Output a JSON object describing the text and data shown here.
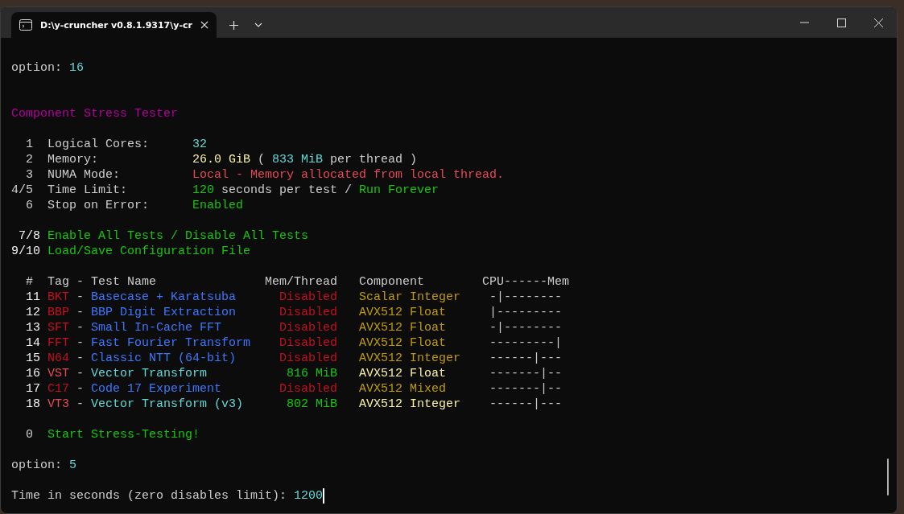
{
  "window": {
    "tabs": [
      {
        "title": "D:\\y-cruncher v0.8.1.9317\\y-cr",
        "selected": true
      }
    ]
  },
  "terminal": {
    "blocks": [
      {
        "kind": "prompt",
        "label": "option:",
        "value": "16"
      },
      {
        "kind": "heading",
        "text": "Component Stress Tester"
      },
      {
        "kind": "settings",
        "items": [
          {
            "key": "1",
            "label": "Logical Cores:",
            "spans": [
              {
                "text": "32",
                "color": "#61d6d6"
              }
            ]
          },
          {
            "key": "2",
            "label": "Memory:",
            "spans": [
              {
                "text": "26.0 GiB",
                "color": "#f9f1a5"
              },
              {
                "text": "(",
                "color": "#cccccc"
              },
              {
                "text": "833 MiB",
                "color": "#61d6d6"
              },
              {
                "text": "per thread )",
                "color": "#cccccc"
              }
            ]
          },
          {
            "key": "3",
            "label": "NUMA Mode:",
            "spans": [
              {
                "text": "Local - Memory allocated from local thread.",
                "color": "#e74856"
              }
            ]
          },
          {
            "key": "4/5",
            "label": "Time Limit:",
            "spans": [
              {
                "text": "120",
                "color": "#16c60c"
              },
              {
                "text": "seconds per test /",
                "color": "#cccccc"
              },
              {
                "text": "Run Forever",
                "color": "#16c60c"
              }
            ]
          },
          {
            "key": "6",
            "label": "Stop on Error:",
            "spans": [
              {
                "text": "Enabled",
                "color": "#16c60c"
              }
            ]
          }
        ]
      },
      {
        "kind": "actions",
        "items": [
          {
            "key": "7/8",
            "text": "Enable All Tests / Disable All Tests"
          },
          {
            "key": "9/10",
            "text": "Load/Save Configuration File"
          }
        ]
      },
      {
        "kind": "table",
        "columns": [
          "#",
          "Tag - Test Name",
          "Mem/Thread",
          "Component",
          "CPU------Mem"
        ],
        "rows": [
          {
            "num": "11",
            "tag": "BKT",
            "sep": "-",
            "name": "Basecase + Karatsuba",
            "mem": "Disabled",
            "component": "Scalar Integer",
            "profile": "-|--------",
            "enabled": false
          },
          {
            "num": "12",
            "tag": "BBP",
            "sep": "-",
            "name": "BBP Digit Extraction",
            "mem": "Disabled",
            "component": "AVX512 Float",
            "profile": "|---------",
            "enabled": false
          },
          {
            "num": "13",
            "tag": "SFT",
            "sep": "-",
            "name": "Small In-Cache FFT",
            "mem": "Disabled",
            "component": "AVX512 Float",
            "profile": "-|--------",
            "enabled": false
          },
          {
            "num": "14",
            "tag": "FFT",
            "sep": "-",
            "name": "Fast Fourier Transform",
            "mem": "Disabled",
            "component": "AVX512 Float",
            "profile": "---------|",
            "enabled": false
          },
          {
            "num": "15",
            "tag": "N64",
            "sep": "-",
            "name": "Classic NTT (64-bit)",
            "mem": "Disabled",
            "component": "AVX512 Integer",
            "profile": "------|---",
            "enabled": false
          },
          {
            "num": "16",
            "tag": "VST",
            "sep": "-",
            "name": "Vector Transform",
            "mem": "816 MiB",
            "component": "AVX512 Float",
            "profile": "-------|--",
            "enabled": true
          },
          {
            "num": "17",
            "tag": "C17",
            "sep": "-",
            "name": "Code 17 Experiment",
            "mem": "Disabled",
            "component": "AVX512 Mixed",
            "profile": "-------|--",
            "enabled": false
          },
          {
            "num": "18",
            "tag": "VT3",
            "sep": "-",
            "name": "Vector Transform (v3)",
            "mem": "802 MiB",
            "component": "AVX512 Integer",
            "profile": "------|---",
            "enabled": true
          }
        ]
      },
      {
        "kind": "start",
        "key": "0",
        "text": "Start Stress-Testing!"
      },
      {
        "kind": "prompt",
        "label": "option:",
        "value": "5"
      },
      {
        "kind": "input",
        "label": "Time in seconds (zero disables limit):",
        "value": "1200"
      }
    ]
  }
}
